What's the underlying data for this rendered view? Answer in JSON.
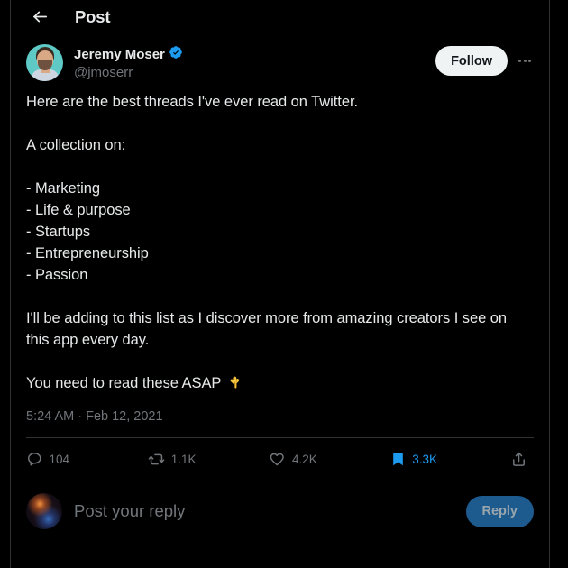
{
  "header": {
    "back_icon": "back-arrow-icon",
    "title": "Post"
  },
  "post": {
    "author": {
      "display_name": "Jeremy Moser",
      "handle": "@jmoserr",
      "verified": true,
      "verified_icon": "verified-badge-icon",
      "avatar_icon": "author-avatar"
    },
    "follow_label": "Follow",
    "more_icon": "more-options-icon",
    "text": "Here are the best threads I've ever read on Twitter.\n\nA collection on:\n\n- Marketing\n- Life & purpose\n- Startups\n- Entrepreneurship\n- Passion\n\nI'll be adding to this list as I discover more from amazing creators I see on this app every day.\n\nYou need to read these ASAP ",
    "emoji": "point-down-emoji",
    "timestamp": "5:24 AM · Feb 12, 2021",
    "actions": [
      {
        "name": "reply",
        "icon": "reply-icon",
        "count": "104"
      },
      {
        "name": "retweet",
        "icon": "retweet-icon",
        "count": "1.1K"
      },
      {
        "name": "like",
        "icon": "heart-icon",
        "count": "4.2K"
      },
      {
        "name": "bookmark",
        "icon": "bookmark-icon",
        "count": "3.3K"
      },
      {
        "name": "share",
        "icon": "share-icon",
        "count": ""
      }
    ]
  },
  "composer": {
    "avatar_icon": "current-user-avatar",
    "placeholder": "Post your reply",
    "value": "",
    "reply_label": "Reply"
  },
  "colors": {
    "background": "#000000",
    "text_primary": "#e7e9ea",
    "text_secondary": "#71767b",
    "border": "#2f3336",
    "accent_blue": "#1d9bf0",
    "reply_button": "#1d5a8e",
    "follow_button": "#eff3f4"
  }
}
